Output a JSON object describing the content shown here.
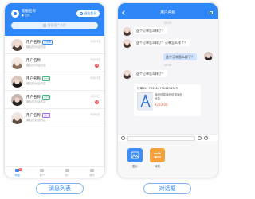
{
  "left_screen": {
    "merchant": {
      "name": "客服名称",
      "status": "● 在线"
    },
    "logout_label": "退出登录",
    "search_placeholder": "搜索用户名称",
    "conversations": [
      {
        "name": "用户名称",
        "tag": "已收单",
        "tag_color": "#3e8ff5",
        "message": "最后的对话内容",
        "time": "8月6日",
        "badge": ""
      },
      {
        "name": "用户名称",
        "tag": "",
        "tag_color": "",
        "message": "最后的对话内容",
        "time": "8月6日",
        "badge": "12"
      },
      {
        "name": "用户名称",
        "tag": "已付",
        "tag_color": "#42b983",
        "message": "最后的对话内容",
        "time": "8月6日",
        "badge": ""
      },
      {
        "name": "用户名称",
        "tag": "已付",
        "tag_color": "#42b983",
        "message": "最后的对话内容",
        "time": "8月6日",
        "badge": "12"
      },
      {
        "name": "用户名称",
        "tag": "待付",
        "tag_color": "#a26bf0",
        "message": "最后的对话内容",
        "time": "8月6日",
        "badge": ""
      }
    ],
    "tabs": [
      {
        "label": "消息",
        "badge": "12",
        "active": true
      },
      {
        "label": "客户",
        "badge": "",
        "active": false
      },
      {
        "label": "统计",
        "badge": "",
        "active": false
      },
      {
        "label": "我的",
        "badge": "",
        "active": false
      }
    ]
  },
  "right_screen": {
    "title": "用户名称",
    "timestamps": [
      "09:02",
      "09:08"
    ],
    "messages": [
      {
        "side": "in",
        "text": "这个订单怎么样了？"
      },
      {
        "side": "in",
        "text": "这个订单怎么样了？订单怎么样了？"
      },
      {
        "side": "out",
        "text": "这个订单怎么样了？"
      },
      {
        "side": "in",
        "text": "这个订单怎么样了？"
      }
    ],
    "order_card": {
      "order_no": "订单ID：7939247924294329",
      "product_name": "商品信息商品信息商品信息",
      "price": "¥233.00"
    },
    "tools": [
      {
        "label": "图片",
        "icon": "image-icon"
      },
      {
        "label": "转接",
        "icon": "transfer-icon"
      }
    ]
  },
  "captions": {
    "left": "消息列表",
    "right": "对话框"
  },
  "colors": {
    "primary": "#2f86f6",
    "badge": "#f24b4b",
    "price": "#f0663b"
  }
}
